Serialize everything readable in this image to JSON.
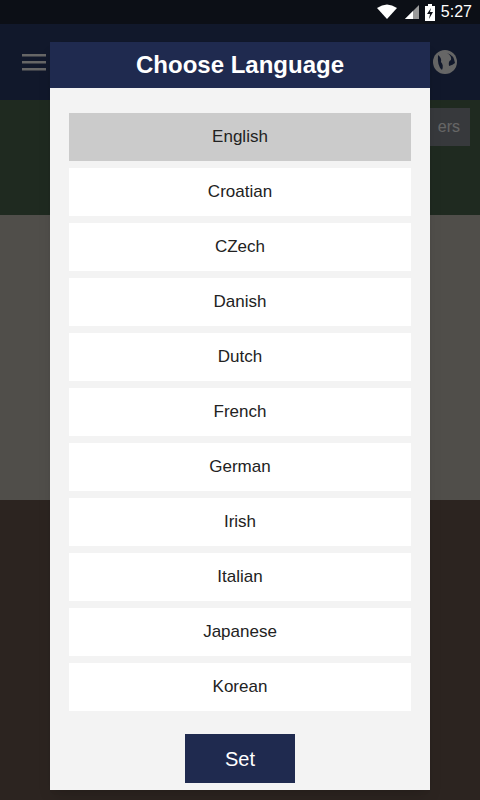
{
  "status_bar": {
    "time": "5:27"
  },
  "background": {
    "button": "ers"
  },
  "dialog": {
    "title": "Choose Language",
    "languages": [
      {
        "label": "English",
        "selected": true
      },
      {
        "label": "Croatian",
        "selected": false
      },
      {
        "label": "CZech",
        "selected": false
      },
      {
        "label": "Danish",
        "selected": false
      },
      {
        "label": "Dutch",
        "selected": false
      },
      {
        "label": "French",
        "selected": false
      },
      {
        "label": "German",
        "selected": false
      },
      {
        "label": "Irish",
        "selected": false
      },
      {
        "label": "Italian",
        "selected": false
      },
      {
        "label": "Japanese",
        "selected": false
      },
      {
        "label": "Korean",
        "selected": false
      }
    ],
    "button": "Set"
  }
}
